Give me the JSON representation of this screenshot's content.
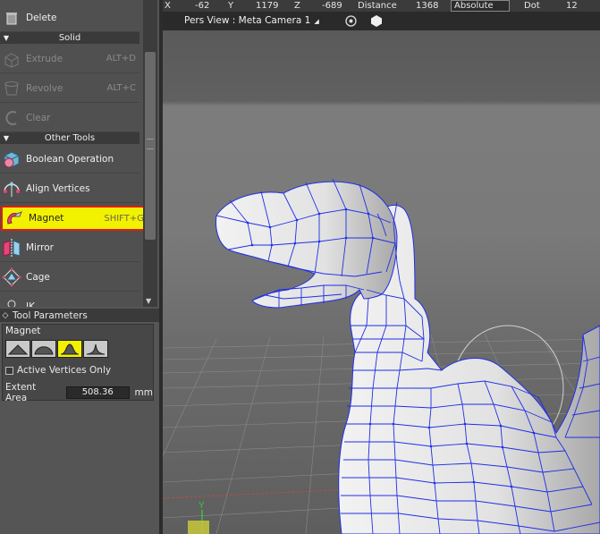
{
  "tools": {
    "items": [
      {
        "label": "Delete",
        "shortcut": "",
        "icon": "delete-icon",
        "enabled": true
      },
      {
        "label": "Extrude",
        "shortcut": "ALT+D",
        "icon": "extrude-icon",
        "enabled": false
      },
      {
        "label": "Revolve",
        "shortcut": "ALT+C",
        "icon": "revolve-icon",
        "enabled": false
      },
      {
        "label": "Clear",
        "shortcut": "",
        "icon": "clear-icon",
        "enabled": false
      },
      {
        "label": "Boolean Operation",
        "shortcut": "",
        "icon": "boolean-icon",
        "enabled": true
      },
      {
        "label": "Align Vertices",
        "shortcut": "",
        "icon": "align-vertices-icon",
        "enabled": true
      },
      {
        "label": "Magnet",
        "shortcut": "SHIFT+G",
        "icon": "magnet-icon",
        "enabled": true,
        "active": true
      },
      {
        "label": "Mirror",
        "shortcut": "",
        "icon": "mirror-icon",
        "enabled": true
      },
      {
        "label": "Cage",
        "shortcut": "",
        "icon": "cage-icon",
        "enabled": true
      },
      {
        "label": "IK",
        "shortcut": "",
        "icon": "ik-icon",
        "enabled": true
      }
    ],
    "sections": [
      "Solid",
      "Other Tools"
    ]
  },
  "tool_parameters": {
    "header": "Tool Parameters",
    "title": "Magnet",
    "falloff_modes": [
      "linear-falloff-icon",
      "dome-falloff-icon",
      "bell-falloff-icon",
      "sharp-falloff-icon"
    ],
    "selected_falloff": 2,
    "active_vertices_only_label": "Active Vertices Only",
    "active_vertices_only": false,
    "extent_label": "Extent Area",
    "extent_value": "508.36",
    "extent_unit": "mm"
  },
  "statusbar": {
    "x_label": "X",
    "x_value": "-62",
    "y_label": "Y",
    "y_value": "1179",
    "z_label": "Z",
    "z_value": "-689",
    "distance_label": "Distance",
    "distance_value": "1368",
    "mode": "Absolute",
    "dot_label": "Dot",
    "dot_value": "12"
  },
  "viewport": {
    "title": "Pers View : Meta Camera 1",
    "target_icon": "target-icon",
    "shape_icon": "hexagon-icon",
    "axis_label": "Y",
    "colors": {
      "wire": "#1f2ee6",
      "bg_top": "#5e5e5e",
      "bg_mid": "#7a7a7a",
      "floor": "#666666",
      "selection": "#e01a1a",
      "highlight": "#f2f200"
    }
  }
}
